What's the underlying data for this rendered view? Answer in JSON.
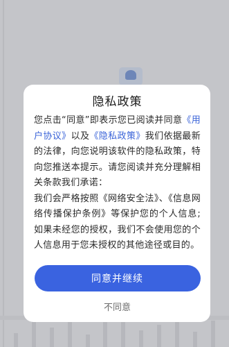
{
  "dialog": {
    "title": "隐私政策",
    "body": {
      "intro_1": "您点击“同意”即表示您已阅读并同意",
      "user_agreement_link": "《用户协议》",
      "intro_2": "以及",
      "privacy_policy_link": "《隐私政策》",
      "intro_3": "我们依据最新的法律，向您说明该软件的隐私政策，特向您推送本提示。请您阅读并充分理解相关条款我们承诺：",
      "promise": "我们会严格按照《网络安全法》、《信息网络传播保护条例》等保护您的个人信息;如果未经您的授权，我们不会使用您的个人信息用于您未授权的其他途径或目的。"
    },
    "agree_button": "同意并继续",
    "disagree_button": "不同意"
  },
  "colors": {
    "accent": "#3a63e0",
    "link": "#3a63d8",
    "overlay": "#c4c5c9"
  }
}
